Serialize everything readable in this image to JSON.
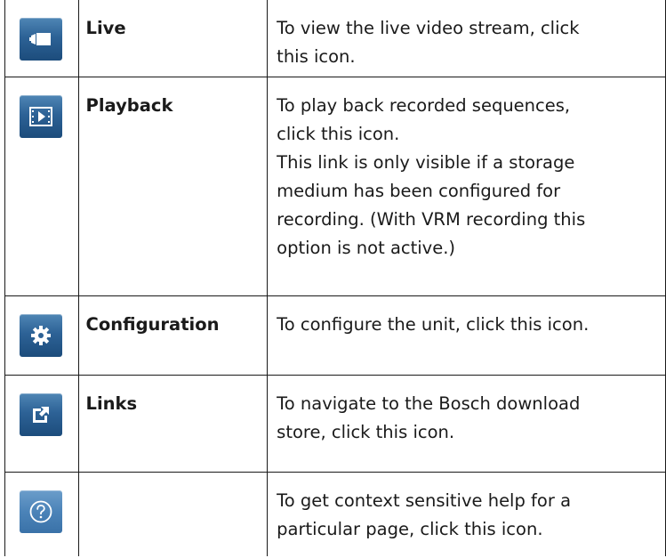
{
  "rows": [
    {
      "icon": "live-video-icon",
      "name": "Live",
      "description": [
        "To view the live video stream, click",
        "this icon."
      ]
    },
    {
      "icon": "playback-icon",
      "name": "Playback",
      "description": [
        "To play back recorded sequences,",
        "click this icon.",
        "This link is only visible if a storage",
        "medium has been configured for",
        "recording. (With VRM recording this",
        "option is not active.)"
      ]
    },
    {
      "icon": "gear-icon",
      "name": "Configuration",
      "description": [
        "To configure the unit, click this icon."
      ]
    },
    {
      "icon": "external-link-icon",
      "name": "Links",
      "description": [
        "To navigate to the Bosch download",
        "store, click this icon."
      ]
    },
    {
      "icon": "help-icon",
      "name": "",
      "description": [
        "To get context sensitive help for a",
        "particular page, click this icon."
      ]
    }
  ]
}
